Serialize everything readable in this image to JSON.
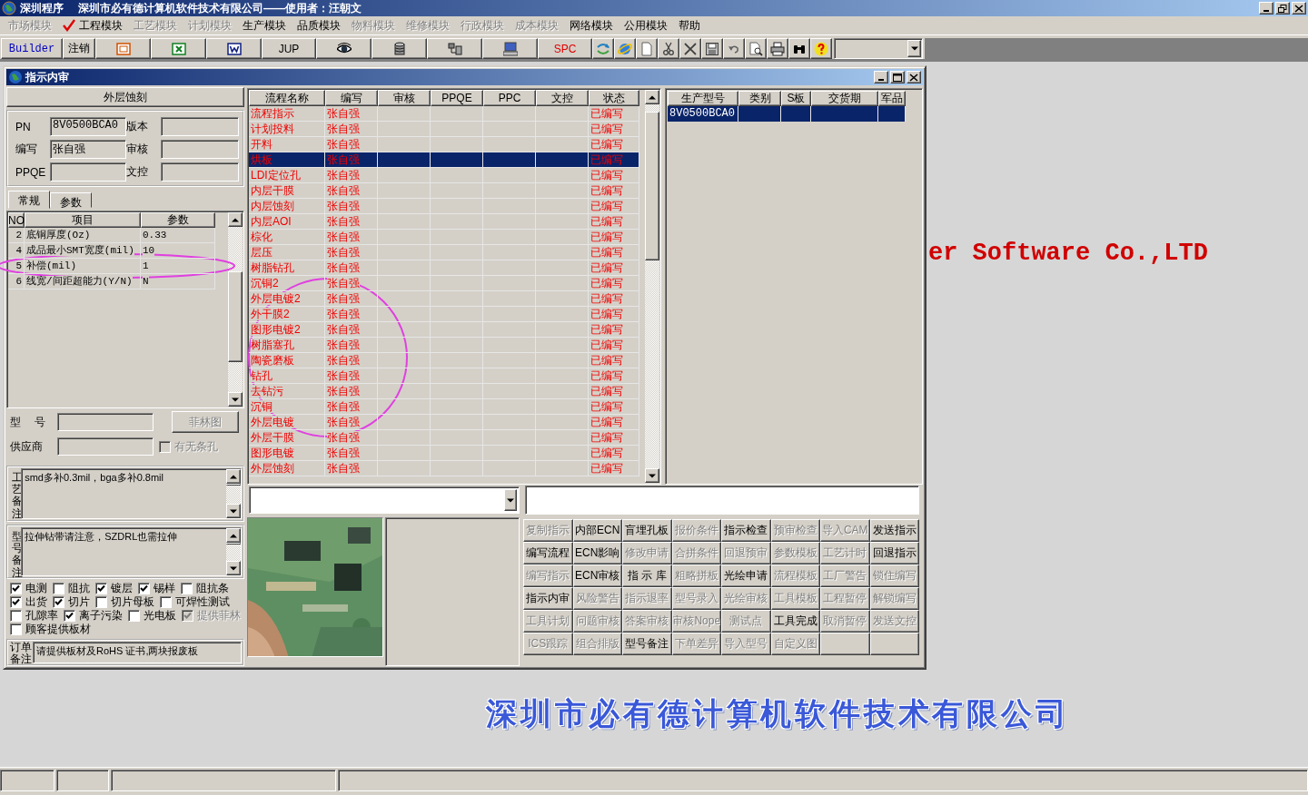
{
  "window": {
    "title": "深圳程序",
    "subtitle": "深圳市必有德计算机软件技术有限公司——使用者：汪朝文"
  },
  "menu": [
    {
      "label": "市场模块",
      "disabled": true,
      "checked": false
    },
    {
      "label": "工程模块",
      "disabled": false,
      "checked": true
    },
    {
      "label": "工艺模块",
      "disabled": true,
      "checked": false
    },
    {
      "label": "计划模块",
      "disabled": true,
      "checked": false
    },
    {
      "label": "生产模块",
      "disabled": false,
      "checked": false
    },
    {
      "label": "品质模块",
      "disabled": false,
      "checked": false
    },
    {
      "label": "物料模块",
      "disabled": true,
      "checked": false
    },
    {
      "label": "维修模块",
      "disabled": true,
      "checked": false
    },
    {
      "label": "行政模块",
      "disabled": true,
      "checked": false
    },
    {
      "label": "成本模块",
      "disabled": true,
      "checked": false
    },
    {
      "label": "网络模块",
      "disabled": false,
      "checked": false
    },
    {
      "label": "公用模块",
      "disabled": false,
      "checked": false
    },
    {
      "label": "帮助",
      "disabled": false,
      "checked": false
    }
  ],
  "toolbar": [
    {
      "kind": "text",
      "label": "Builder",
      "color": "#0000c0"
    },
    {
      "kind": "text",
      "label": "注销",
      "color": "#000000"
    },
    {
      "kind": "icon"
    },
    {
      "kind": "icon"
    },
    {
      "kind": "icon"
    },
    {
      "kind": "text",
      "label": "JUP",
      "color": "#000000"
    },
    {
      "kind": "icon"
    },
    {
      "kind": "icon"
    },
    {
      "kind": "icon"
    },
    {
      "kind": "icon"
    },
    {
      "kind": "text",
      "label": "SPC",
      "color": "#e00000"
    },
    {
      "kind": "small-icon"
    },
    {
      "kind": "small-icon"
    },
    {
      "kind": "small-icon"
    },
    {
      "kind": "small-icon"
    },
    {
      "kind": "small-icon"
    },
    {
      "kind": "small-icon"
    },
    {
      "kind": "small-icon"
    },
    {
      "kind": "small-icon"
    },
    {
      "kind": "small-icon"
    },
    {
      "kind": "small-icon"
    },
    {
      "kind": "small-icon"
    }
  ],
  "backdrop": {
    "english_text": "er Software Co.,LTD",
    "chinese_text": "深圳市必有德计算机软件技术有限公司"
  },
  "child_window": {
    "title": "指示内审"
  },
  "left_panel": {
    "heading": "外层蚀刻",
    "fields": [
      {
        "label": "PN",
        "value": "8V0500BCA0"
      },
      {
        "label": "版本"
      },
      {
        "label": "编写",
        "value": "张自强"
      },
      {
        "label": "审核"
      },
      {
        "label": "PPQE"
      },
      {
        "label": "文控"
      }
    ],
    "tabs": [
      {
        "label": "常规",
        "selected": true
      },
      {
        "label": "参数",
        "selected": false
      }
    ],
    "param_table": {
      "columns": [
        "NO",
        "项目",
        "参数"
      ],
      "rows": [
        [
          "2",
          "底铜厚度(Oz)",
          "0.33"
        ],
        [
          "4",
          "成品最小SMT宽度(mil)",
          "10"
        ],
        [
          "5",
          "补偿(mil)",
          "1"
        ],
        [
          "6",
          "线宽/间距超能力(Y/N)",
          "N"
        ]
      ]
    },
    "model_label": "型 号",
    "film_button": {
      "label": "菲林图",
      "disabled": true
    },
    "supplier_label": "供应商",
    "slot_checkbox": {
      "label": "有无条孔",
      "checked": false,
      "disabled": true
    },
    "process_note": {
      "label": "工艺备注",
      "text": "smd多补0.3mil，bga多补0.8mil"
    },
    "model_note": {
      "label": "型号备注",
      "text": "拉伸钻带请注意，SZDRL也需拉伸"
    },
    "checkbox_rows": [
      [
        {
          "label": "电测",
          "checked": true,
          "disabled": false
        },
        {
          "label": "阻抗",
          "checked": false,
          "disabled": false
        },
        {
          "label": "镀层",
          "checked": true,
          "disabled": false
        },
        {
          "label": "锡样",
          "checked": true,
          "disabled": false
        },
        {
          "label": "阻抗条",
          "checked": false,
          "disabled": false
        }
      ],
      [
        {
          "label": "出货",
          "checked": true,
          "disabled": false
        },
        {
          "label": "切片",
          "checked": true,
          "disabled": false
        },
        {
          "label": "切片母板",
          "checked": false,
          "disabled": false
        },
        {
          "label": "可焊性测试",
          "checked": false,
          "disabled": false
        }
      ],
      [
        {
          "label": "孔隙率",
          "checked": false,
          "disabled": false
        },
        {
          "label": "离子污染",
          "checked": true,
          "disabled": false
        },
        {
          "label": "光电板",
          "checked": false,
          "disabled": false
        },
        {
          "label": "提供菲林",
          "checked": true,
          "disabled": true
        }
      ],
      [
        {
          "label": "顾客提供板材",
          "checked": false,
          "disabled": false
        }
      ]
    ],
    "order_note": {
      "label": "订单备注",
      "text": "请提供板材及RoHS 证书,两块报废板"
    }
  },
  "flow_table": {
    "columns": [
      "流程名称",
      "编写",
      "审核",
      "PPQE",
      "PPC",
      "文控",
      "状态"
    ],
    "rows": [
      {
        "name": "流程指示",
        "writer": "张自强",
        "status": "已编写",
        "selected": false
      },
      {
        "name": "计划投料",
        "writer": "张自强",
        "status": "已编写",
        "selected": false
      },
      {
        "name": "开料",
        "writer": "张自强",
        "status": "已编写",
        "selected": false
      },
      {
        "name": "烘板",
        "writer": "张自强",
        "status": "已编写",
        "selected": true
      },
      {
        "name": "LDI定位孔",
        "writer": "张自强",
        "status": "已编写",
        "selected": false
      },
      {
        "name": "内层干膜",
        "writer": "张自强",
        "status": "已编写",
        "selected": false
      },
      {
        "name": "内层蚀刻",
        "writer": "张自强",
        "status": "已编写",
        "selected": false
      },
      {
        "name": "内层AOI",
        "writer": "张自强",
        "status": "已编写",
        "selected": false
      },
      {
        "name": "棕化",
        "writer": "张自强",
        "status": "已编写",
        "selected": false
      },
      {
        "name": "层压",
        "writer": "张自强",
        "status": "已编写",
        "selected": false
      },
      {
        "name": "树脂钻孔",
        "writer": "张自强",
        "status": "已编写",
        "selected": false
      },
      {
        "name": "沉铜2",
        "writer": "张自强",
        "status": "已编写",
        "selected": false
      },
      {
        "name": "外层电镀2",
        "writer": "张自强",
        "status": "已编写",
        "selected": false
      },
      {
        "name": "外干膜2",
        "writer": "张自强",
        "status": "已编写",
        "selected": false
      },
      {
        "name": "图形电镀2",
        "writer": "张自强",
        "status": "已编写",
        "selected": false
      },
      {
        "name": "树脂塞孔",
        "writer": "张自强",
        "status": "已编写",
        "selected": false
      },
      {
        "name": "陶瓷磨板",
        "writer": "张自强",
        "status": "已编写",
        "selected": false
      },
      {
        "name": "钻孔",
        "writer": "张自强",
        "status": "已编写",
        "selected": false
      },
      {
        "name": "去钻污",
        "writer": "张自强",
        "status": "已编写",
        "selected": false
      },
      {
        "name": "沉铜",
        "writer": "张自强",
        "status": "已编写",
        "selected": false
      },
      {
        "name": "外层电镀",
        "writer": "张自强",
        "status": "已编写",
        "selected": false
      },
      {
        "name": "外层干膜",
        "writer": "张自强",
        "status": "已编写",
        "selected": false
      },
      {
        "name": "图形电镀",
        "writer": "张自强",
        "status": "已编写",
        "selected": false
      },
      {
        "name": "外层蚀刻",
        "writer": "张自强",
        "status": "已编写",
        "selected": false
      }
    ]
  },
  "model_table": {
    "columns": [
      "生产型号",
      "类别",
      "S板",
      "交货期",
      "军品"
    ],
    "rows": [
      {
        "model": "8V0500BCA0",
        "selected": true
      }
    ]
  },
  "buttons": [
    {
      "label": "复制指示",
      "disabled": true
    },
    {
      "label": "内部ECN",
      "disabled": false
    },
    {
      "label": "盲埋孔板",
      "disabled": false
    },
    {
      "label": "报价条件",
      "disabled": true
    },
    {
      "label": "指示检查",
      "disabled": false
    },
    {
      "label": "预审检查",
      "disabled": true
    },
    {
      "label": "导入CAM",
      "disabled": true
    },
    {
      "label": "发送指示",
      "disabled": false
    },
    {
      "label": "编写流程",
      "disabled": false
    },
    {
      "label": "ECN影响",
      "disabled": false
    },
    {
      "label": "修改申请",
      "disabled": true
    },
    {
      "label": "合拼条件",
      "disabled": true
    },
    {
      "label": "回退预审",
      "disabled": true
    },
    {
      "label": "参数模板",
      "disabled": true
    },
    {
      "label": "工艺计时",
      "disabled": true
    },
    {
      "label": "回退指示",
      "disabled": false
    },
    {
      "label": "编写指示",
      "disabled": true
    },
    {
      "label": "ECN审核",
      "disabled": false
    },
    {
      "label": "指 示 库",
      "disabled": false
    },
    {
      "label": "粗略拼板",
      "disabled": true
    },
    {
      "label": "光绘申请",
      "disabled": false
    },
    {
      "label": "流程模板",
      "disabled": true
    },
    {
      "label": "工厂警告",
      "disabled": true
    },
    {
      "label": "锁住编写",
      "disabled": true
    },
    {
      "label": "指示内审",
      "disabled": false
    },
    {
      "label": "风险警告",
      "disabled": true
    },
    {
      "label": "指示退率",
      "disabled": true
    },
    {
      "label": "型号录入",
      "disabled": true
    },
    {
      "label": "光绘审核",
      "disabled": true
    },
    {
      "label": "工具模板",
      "disabled": true
    },
    {
      "label": "工程暂停",
      "disabled": true
    },
    {
      "label": "解锁编写",
      "disabled": true
    },
    {
      "label": "工具计划",
      "disabled": true
    },
    {
      "label": "问题审核",
      "disabled": true
    },
    {
      "label": "答案审核",
      "disabled": true
    },
    {
      "label": "审核Nope",
      "disabled": true
    },
    {
      "label": "测试点",
      "disabled": true
    },
    {
      "label": "工具完成",
      "disabled": false
    },
    {
      "label": "取消暂停",
      "disabled": true
    },
    {
      "label": "发送文控",
      "disabled": true
    },
    {
      "label": "ICS跟踪",
      "disabled": true
    },
    {
      "label": "组合排版",
      "disabled": true
    },
    {
      "label": "型号备注",
      "disabled": false
    },
    {
      "label": "下单差异",
      "disabled": true
    },
    {
      "label": "导入型号",
      "disabled": true
    },
    {
      "label": "自定义图",
      "disabled": true
    }
  ],
  "annotations": [
    {
      "kind": "ellipse"
    },
    {
      "kind": "ellipse"
    }
  ]
}
